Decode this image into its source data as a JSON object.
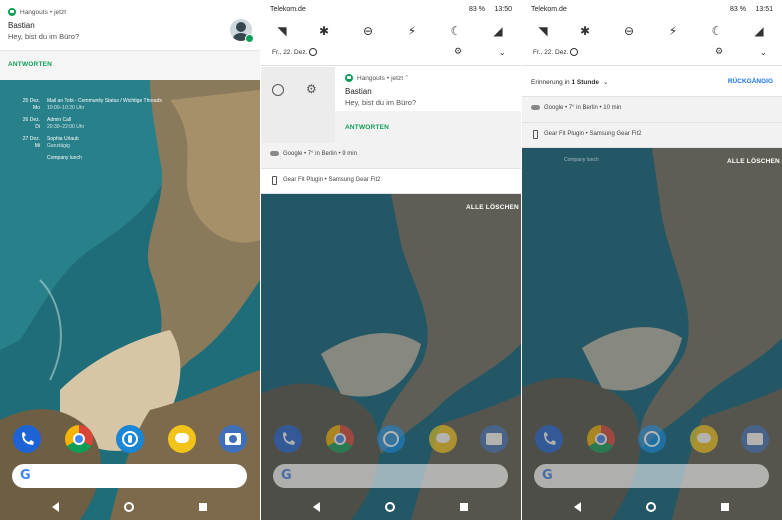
{
  "panel1": {
    "notification": {
      "app": "Hangouts",
      "time": "jetzt",
      "title": "Bastian",
      "text": "Hey, bist du im Büro?",
      "action": "ANTWORTEN"
    },
    "agenda": [
      {
        "date": "25 Dez.",
        "weekday": "Mo",
        "title": "Mail an Tobi - Community Status / Wichtige Threads",
        "time": "10:00–10:20 Uhr"
      },
      {
        "date": "26 Dez.",
        "weekday": "Di",
        "title": "Admin Call",
        "time": "20:30–22:00 Uhr"
      },
      {
        "date": "27 Dez.",
        "weekday": "Mi",
        "title": "Sophia Urlaub",
        "time": "Ganztägig"
      },
      {
        "date": "",
        "weekday": "",
        "title": "Company lunch",
        "time": ""
      }
    ]
  },
  "panel2": {
    "status": {
      "carrier": "Telekom.de",
      "battery": "83 %",
      "time": "13:50"
    },
    "date": "Fr., 22. Dez.",
    "notification": {
      "app": "Hangouts",
      "time": "jetzt",
      "title": "Bastian",
      "text": "Hey, bist du im Büro?",
      "action": "ANTWORTEN"
    },
    "google_row": "Google • 7° in Berlin • 9 min",
    "gearfit_row": "Gear Fit Plugin • Samsung Gear Fit2",
    "clear_all": "ALLE LÖSCHEN"
  },
  "panel3": {
    "status": {
      "carrier": "Telekom.de",
      "battery": "83 %",
      "time": "13:51"
    },
    "date": "Fr., 22. Dez.",
    "reminder_prefix": "Erinnerung in ",
    "reminder_bold": "1 Stunde",
    "undo": "RÜCKGÄNGIG",
    "google_row": "Google • 7° in Berlin • 10 min",
    "gearfit_row": "Gear Fit Plugin • Samsung Gear Fit2",
    "company_lunch": "Company lunch",
    "clear_all": "ALLE LÖSCHEN"
  },
  "colors": {
    "hangouts": "#0f9d58",
    "link": "#1a73e8"
  }
}
